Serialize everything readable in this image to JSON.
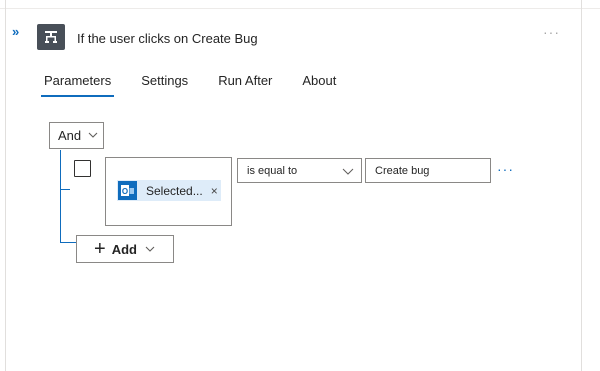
{
  "header": {
    "collapse_glyph": "»",
    "title": "If the user clicks on Create Bug",
    "more_glyph": "···"
  },
  "tabs": [
    {
      "label": "Parameters",
      "active": true
    },
    {
      "label": "Settings",
      "active": false
    },
    {
      "label": "Run After",
      "active": false
    },
    {
      "label": "About",
      "active": false
    }
  ],
  "condition": {
    "group_operator": "And",
    "row": {
      "left_token_label": "Selected...",
      "left_token_close": "×",
      "left_token_icon": "outlook-icon",
      "operator": "is equal to",
      "value": "Create bug",
      "more_glyph": "···"
    },
    "add_label": "Add",
    "add_glyph": "+"
  },
  "colors": {
    "accent": "#0f6cbd",
    "icon_bg": "#484f58",
    "token_bg": "#deecf9"
  }
}
